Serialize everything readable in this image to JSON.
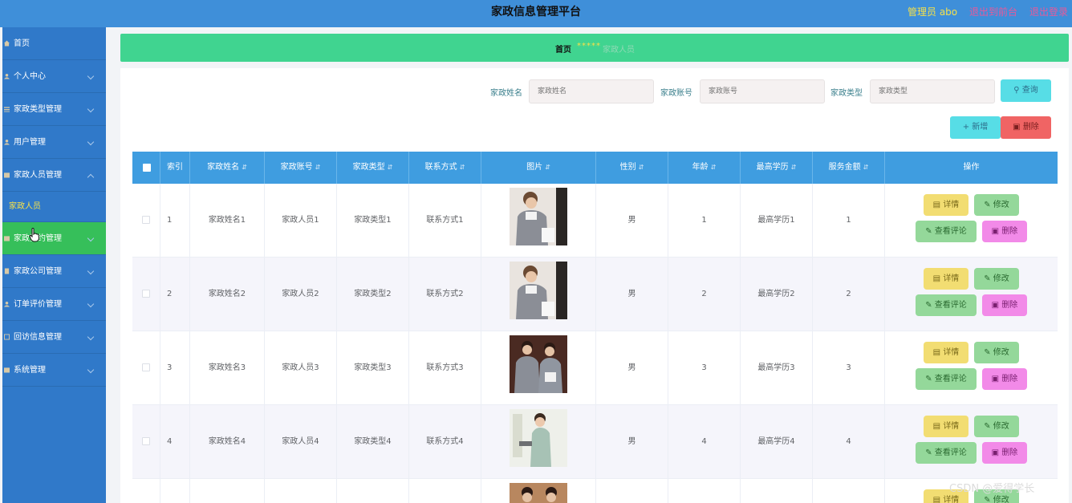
{
  "header": {
    "title": "家政信息管理平台",
    "admin": "管理员 abo",
    "back_front": "退出到前台",
    "logout": "退出登录"
  },
  "sidebar": {
    "items": [
      {
        "label": "首页"
      },
      {
        "label": "个人中心"
      },
      {
        "label": "家政类型管理"
      },
      {
        "label": "用户管理"
      },
      {
        "label": "家政人员管理"
      },
      {
        "label": "家政预约管理"
      },
      {
        "label": "家政公司管理"
      },
      {
        "label": "订单评价管理"
      },
      {
        "label": "回访信息管理"
      },
      {
        "label": "系统管理"
      }
    ],
    "sub_item": "家政人员"
  },
  "breadcrumb": {
    "home": "首页",
    "separator": "*****",
    "current": "家政人员"
  },
  "search": {
    "name_label": "家政姓名",
    "name_placeholder": "家政姓名",
    "account_label": "家政账号",
    "account_placeholder": "家政账号",
    "type_label": "家政类型",
    "type_placeholder": "家政类型",
    "query_button": "查询"
  },
  "toolbar": {
    "add_button": "新增",
    "delete_button": "删除"
  },
  "table": {
    "headers": [
      "索引",
      "家政姓名",
      "家政账号",
      "家政类型",
      "联系方式",
      "图片",
      "性别",
      "年龄",
      "最高学历",
      "服务金额",
      "操作"
    ],
    "rows": [
      {
        "index": "1",
        "name": "家政姓名1",
        "account": "家政人员1",
        "type": "家政类型1",
        "contact": "联系方式1",
        "gender": "男",
        "age": "1",
        "education": "最高学历1",
        "amount": "1"
      },
      {
        "index": "2",
        "name": "家政姓名2",
        "account": "家政人员2",
        "type": "家政类型2",
        "contact": "联系方式2",
        "gender": "男",
        "age": "2",
        "education": "最高学历2",
        "amount": "2"
      },
      {
        "index": "3",
        "name": "家政姓名3",
        "account": "家政人员3",
        "type": "家政类型3",
        "contact": "联系方式3",
        "gender": "男",
        "age": "3",
        "education": "最高学历3",
        "amount": "3"
      },
      {
        "index": "4",
        "name": "家政姓名4",
        "account": "家政人员4",
        "type": "家政类型4",
        "contact": "联系方式4",
        "gender": "男",
        "age": "4",
        "education": "最高学历4",
        "amount": "4"
      }
    ],
    "actions": {
      "detail": "详情",
      "edit": "修改",
      "review": "查看评论",
      "remove": "删除"
    }
  },
  "watermark": "CSDN @爱得学长",
  "colors": {
    "topbar": "#3f8fd9",
    "sidebar": "#3079c9",
    "active_menu": "#36bf5a",
    "breadcrumb": "#40d490",
    "table_header": "#3f9de0"
  }
}
